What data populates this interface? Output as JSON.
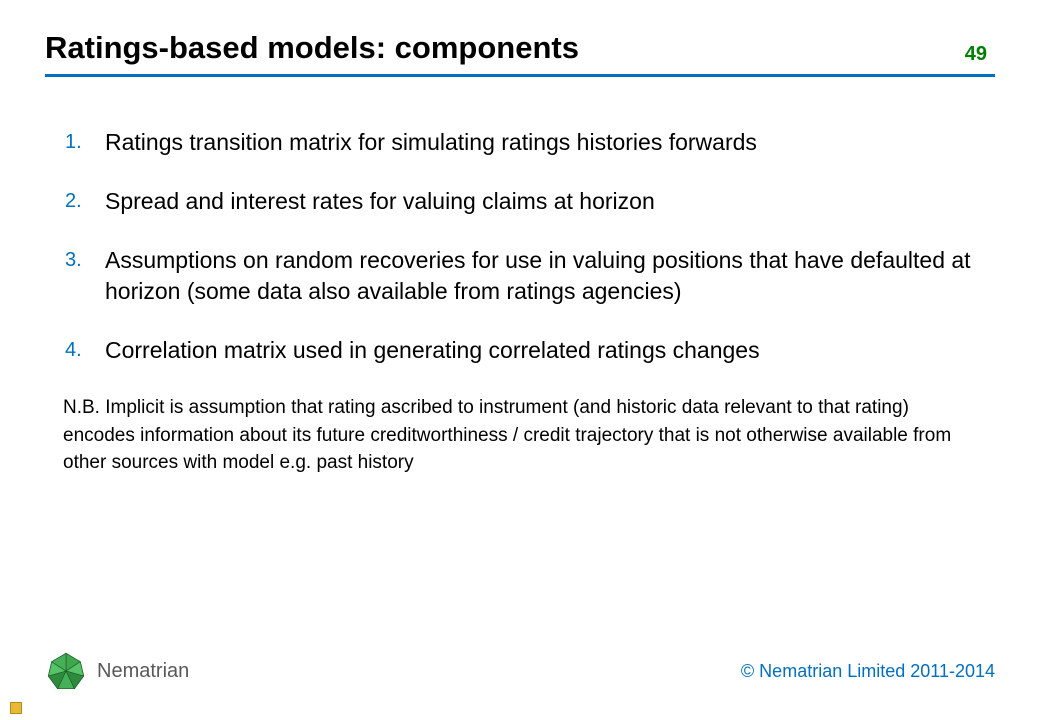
{
  "header": {
    "title": "Ratings-based models: components",
    "page_number": "49"
  },
  "list_items": [
    "Ratings transition matrix for simulating ratings histories forwards",
    "Spread and interest rates for valuing claims at horizon",
    "Assumptions on random recoveries for use in valuing positions that have defaulted at horizon (some data also available from ratings agencies)",
    "Correlation matrix used in generating correlated ratings changes"
  ],
  "note": "N.B. Implicit is assumption that rating ascribed to instrument (and historic data relevant to that rating) encodes information about its future creditworthiness / credit trajectory that is not otherwise available from other sources with model e.g. past history",
  "footer": {
    "brand": "Nematrian",
    "copyright": "© Nematrian Limited 2011-2014"
  },
  "colors": {
    "accent_blue": "#0070c0",
    "page_number_green": "#008000",
    "brand_grey": "#595959"
  }
}
